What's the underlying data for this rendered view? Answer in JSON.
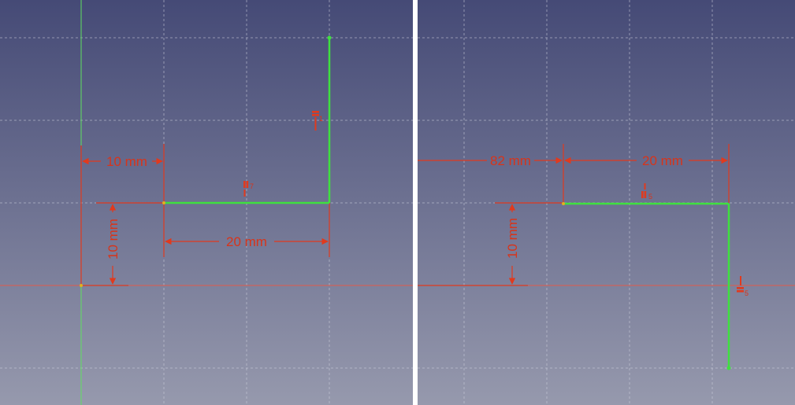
{
  "colors": {
    "background_top": "#454a76",
    "background_bottom": "#9699ad",
    "grid": "#d0d2de",
    "geometry": "#3fe03f",
    "constraint": "#e03a1e",
    "axis": "#e05a4a"
  },
  "left_view": {
    "dimensions": {
      "horizontal_top": "10 mm",
      "vertical_left": "10 mm",
      "horizontal_bottom": "20 mm"
    },
    "constraint_icons": {
      "horizontal": "horizontal-constraint-icon",
      "vertical": "vertical-constraint-icon"
    },
    "constraint_index": {
      "horizontal": "7",
      "vertical": "1"
    }
  },
  "right_view": {
    "dimensions": {
      "horizontal_left": "82 mm",
      "horizontal_right": "20 mm",
      "vertical": "10 mm"
    },
    "constraint_index": {
      "horizontal": "5",
      "vertical": "5"
    }
  }
}
